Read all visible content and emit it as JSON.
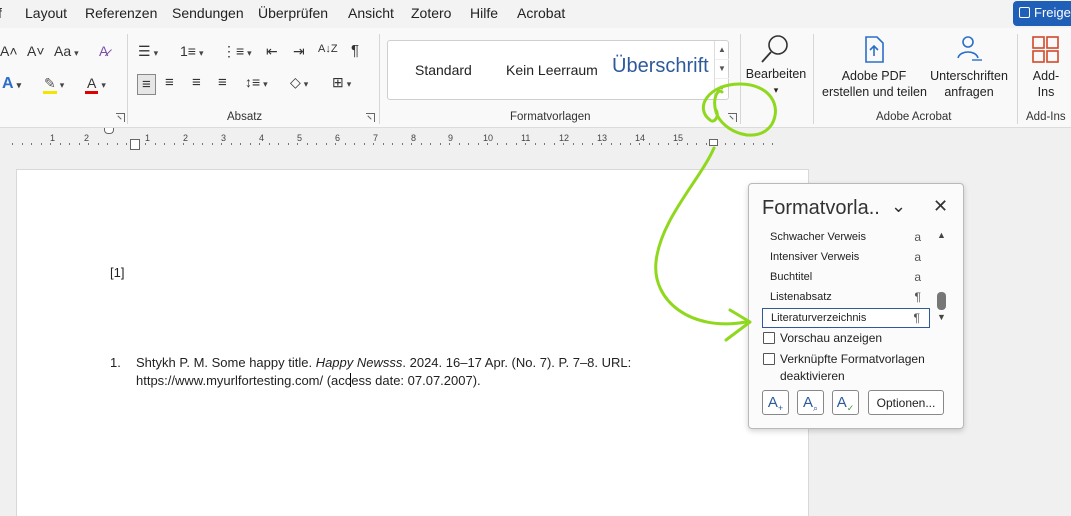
{
  "menu": {
    "items": [
      "f",
      "Layout",
      "Referenzen",
      "Sendungen",
      "Überprüfen",
      "Ansicht",
      "Zotero",
      "Hilfe",
      "Acrobat"
    ],
    "share_label": "Freige"
  },
  "ribbon": {
    "font_group": {
      "grow_font": "A˄",
      "shrink_font": "A˅",
      "change_case": "Aa",
      "clear_format": "A̷",
      "text_effects": "A",
      "highlight": "✎",
      "font_color": "A"
    },
    "paragraph_group": {
      "label": "Absatz",
      "bullets": "☰",
      "numbering": "1≡",
      "multilevel": "⋮≡",
      "decrease_indent": "⇤",
      "increase_indent": "⇥",
      "sort": "A↓Z",
      "show_marks": "¶",
      "align_left": "≡",
      "align_center": "≡",
      "align_right": "≡",
      "justify": "≡",
      "line_spacing": "↕≡",
      "shading": "◇",
      "borders": "⊞"
    },
    "styles_group": {
      "label": "Formatvorlagen",
      "items": [
        "Standard",
        "Kein Leerraum",
        "Überschrift"
      ]
    },
    "editing": {
      "label": "Bearbeiten"
    },
    "acrobat_group": {
      "label": "Adobe Acrobat",
      "create_pdf": [
        "Adobe PDF",
        "erstellen und teilen"
      ],
      "signatures": [
        "Unterschriften",
        "anfragen"
      ]
    },
    "addins_group": {
      "label": "Add-Ins",
      "button": [
        "Add-",
        "Ins"
      ]
    }
  },
  "ruler": {
    "numbers": [
      "1",
      "2",
      "1",
      "2",
      "3",
      "4",
      "5",
      "6",
      "7",
      "8",
      "9",
      "10",
      "11",
      "12",
      "13",
      "14",
      "15"
    ]
  },
  "document": {
    "citation_marker": "[1]",
    "reference": {
      "number": "1.",
      "line1_before": "Shtykh P. M. Some happy title. ",
      "line1_italic": "Happy Newsss",
      "line1_after": ". 2024. 16–17 Apr. (No. 7). P. 7–8. URL:",
      "line2_before": "https://www.myurlfortesting.com/ (acc",
      "line2_after": "ess date: 07.07.2007)."
    }
  },
  "styles_pane": {
    "title": "Formatvorla..",
    "items": [
      {
        "name": "Schwacher Verweis",
        "glyph": "a"
      },
      {
        "name": "Intensiver Verweis",
        "glyph": "a"
      },
      {
        "name": "Buchtitel",
        "glyph": "a"
      },
      {
        "name": "Listenabsatz",
        "glyph": "¶"
      },
      {
        "name": "Literaturverzeichnis",
        "glyph": "¶"
      }
    ],
    "selected_index": 4,
    "preview_label": "Vorschau anzeigen",
    "linked_label_1": "Verknüpfte Formatvorlagen",
    "linked_label_2": "deaktivieren",
    "options_label": "Optionen..."
  },
  "colors": {
    "accent": "#2e5a9c",
    "share": "#1f5fb8",
    "annotation": "#8fd81e"
  }
}
